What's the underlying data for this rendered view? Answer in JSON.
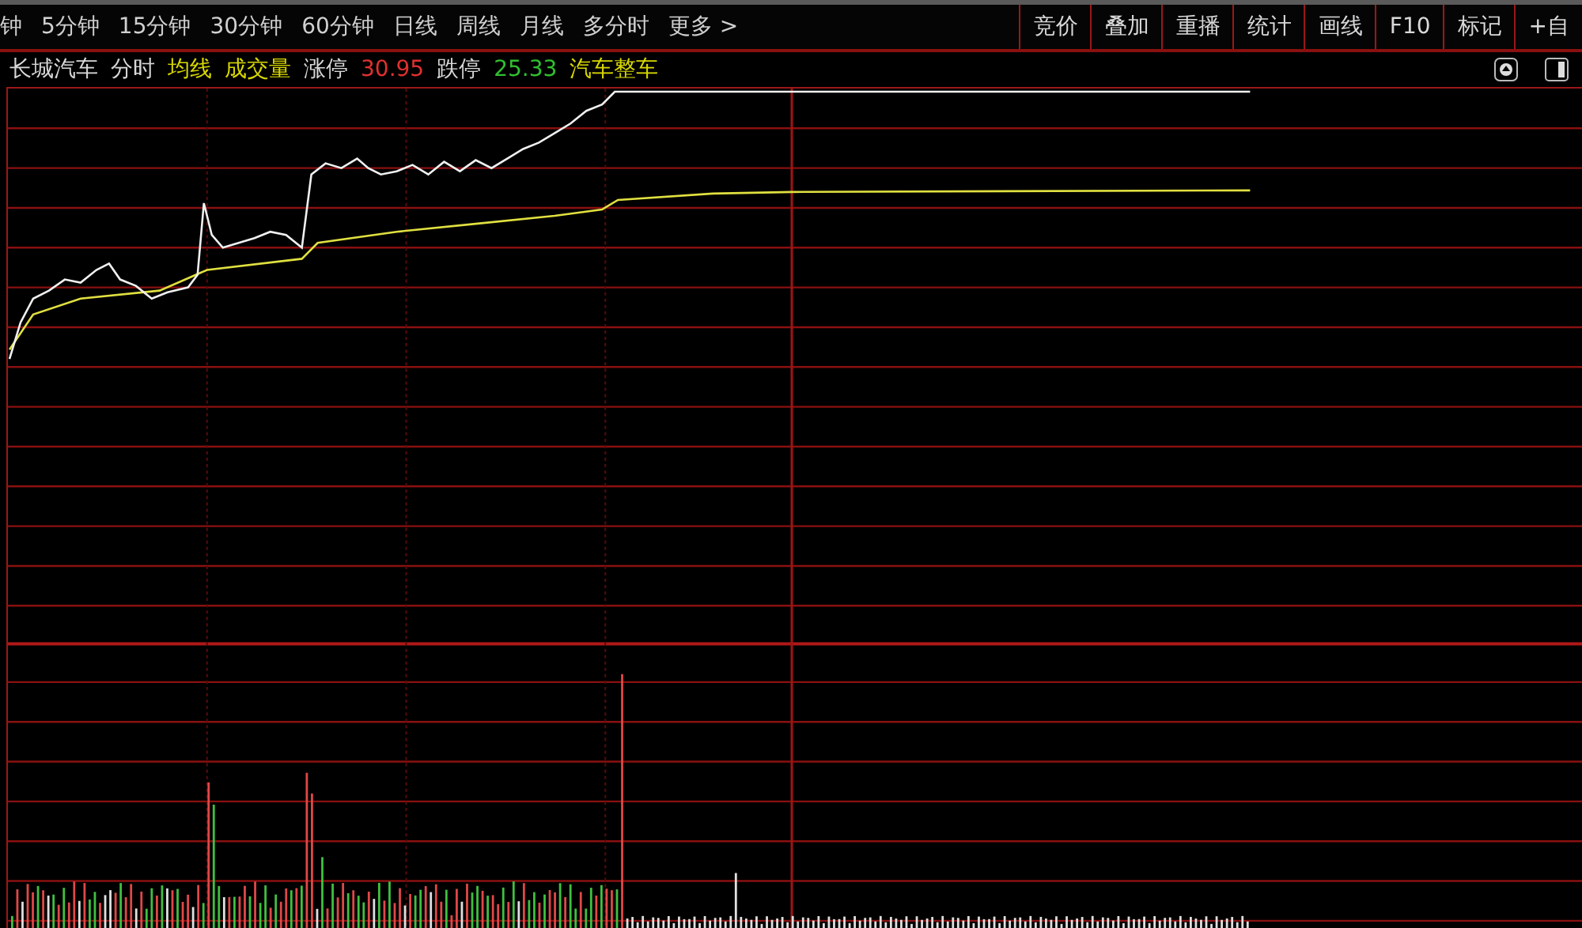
{
  "period_tabs": [
    "钟",
    "5分钟",
    "15分钟",
    "30分钟",
    "60分钟",
    "日线",
    "周线",
    "月线",
    "多分时",
    "更多 >"
  ],
  "tool_buttons": [
    "竞价",
    "叠加",
    "重播",
    "统计",
    "画线",
    "F10",
    "标记",
    "+自"
  ],
  "info_items": [
    {
      "kind": "name",
      "text": "长城汽车"
    },
    {
      "kind": "label",
      "text": "分时"
    },
    {
      "kind": "indicator",
      "text": "均线"
    },
    {
      "kind": "indicator",
      "text": "成交量"
    },
    {
      "kind": "label",
      "text": "涨停"
    },
    {
      "kind": "up",
      "text": "30.95"
    },
    {
      "kind": "label",
      "text": "跌停"
    },
    {
      "kind": "down",
      "text": "25.33"
    },
    {
      "kind": "indicator",
      "text": "汽车整车"
    }
  ]
}
